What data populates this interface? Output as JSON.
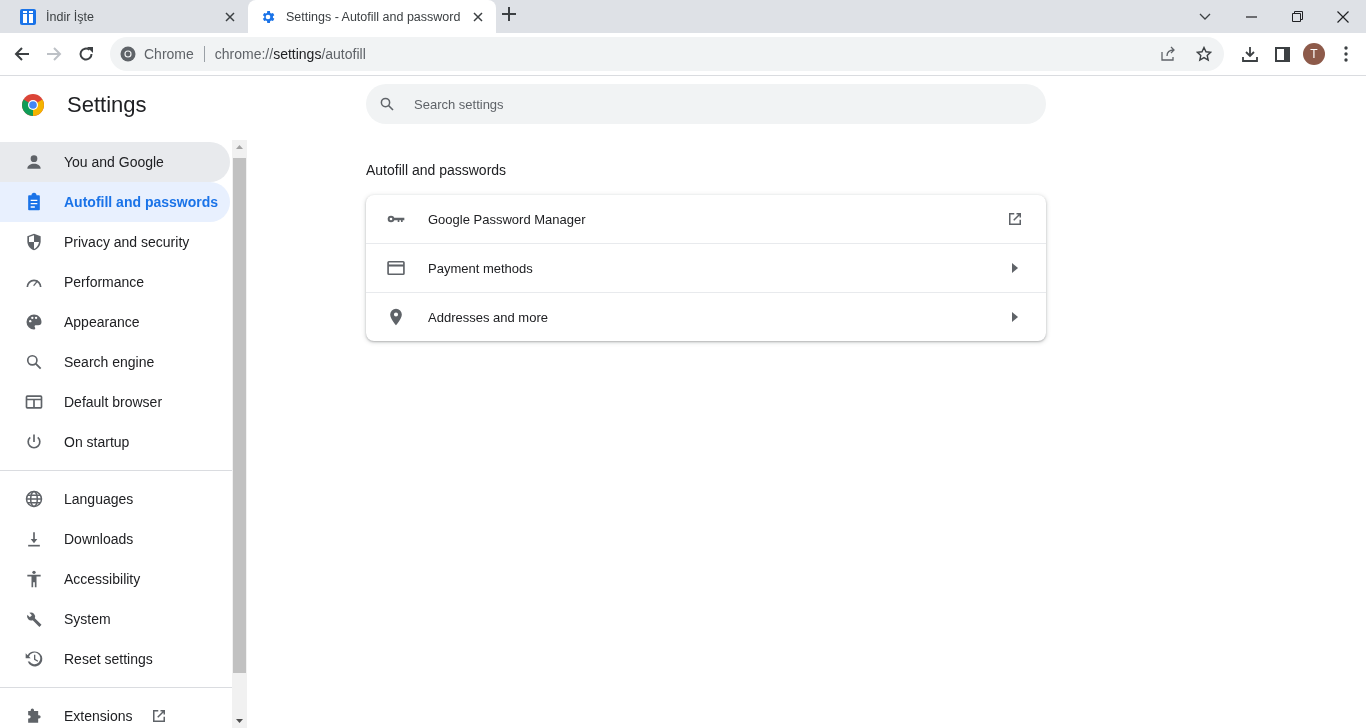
{
  "tabs": [
    {
      "title": "İndir İşte",
      "selected": false
    },
    {
      "title": "Settings - Autofill and password",
      "selected": true
    }
  ],
  "address_bar": {
    "site_label": "Chrome",
    "url_prefix": "chrome://",
    "url_host": "settings",
    "url_path": "/autofill"
  },
  "profile": {
    "initial": "T"
  },
  "sidebar": {
    "title": "Settings",
    "groups": [
      [
        {
          "label": "You and Google",
          "selected": false,
          "hovered": true
        },
        {
          "label": "Autofill and passwords",
          "selected": true,
          "hovered": false
        },
        {
          "label": "Privacy and security",
          "selected": false,
          "hovered": false
        },
        {
          "label": "Performance",
          "selected": false,
          "hovered": false
        },
        {
          "label": "Appearance",
          "selected": false,
          "hovered": false
        },
        {
          "label": "Search engine",
          "selected": false,
          "hovered": false
        },
        {
          "label": "Default browser",
          "selected": false,
          "hovered": false
        },
        {
          "label": "On startup",
          "selected": false,
          "hovered": false
        }
      ],
      [
        {
          "label": "Languages",
          "selected": false,
          "hovered": false
        },
        {
          "label": "Downloads",
          "selected": false,
          "hovered": false
        },
        {
          "label": "Accessibility",
          "selected": false,
          "hovered": false
        },
        {
          "label": "System",
          "selected": false,
          "hovered": false
        },
        {
          "label": "Reset settings",
          "selected": false,
          "hovered": false
        }
      ],
      [
        {
          "label": "Extensions",
          "selected": false,
          "hovered": false,
          "external": true
        }
      ]
    ]
  },
  "search": {
    "placeholder": "Search settings"
  },
  "section": {
    "title": "Autofill and passwords",
    "rows": [
      {
        "label": "Google Password Manager",
        "kind": "external"
      },
      {
        "label": "Payment methods",
        "kind": "submenu"
      },
      {
        "label": "Addresses and more",
        "kind": "submenu"
      }
    ]
  }
}
